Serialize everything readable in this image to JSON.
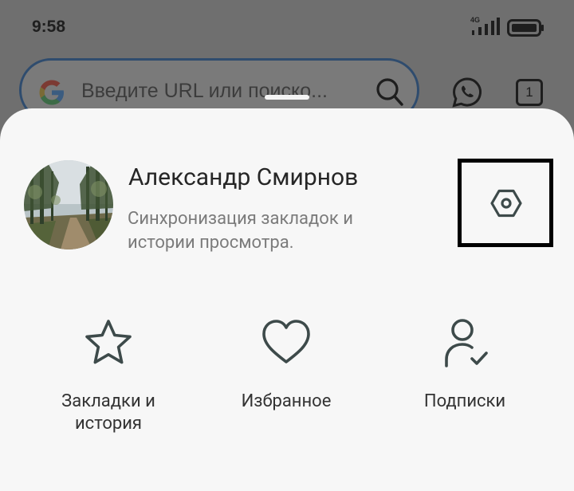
{
  "status_bar": {
    "time": "9:58",
    "network": "4G"
  },
  "browser": {
    "url_placeholder": "Введите URL или поиско...",
    "tab_count": "1"
  },
  "profile": {
    "name": "Александр Смирнов",
    "subtitle": "Синхронизация закладок и истории просмотра."
  },
  "actions": [
    {
      "label": "Закладки и история",
      "icon": "star-icon"
    },
    {
      "label": "Избранное",
      "icon": "heart-icon"
    },
    {
      "label": "Подписки",
      "icon": "person-check-icon"
    }
  ],
  "colors": {
    "icon": "#3d4a4a",
    "sheet": "#f7f7f7",
    "highlight_border": "#000000"
  }
}
